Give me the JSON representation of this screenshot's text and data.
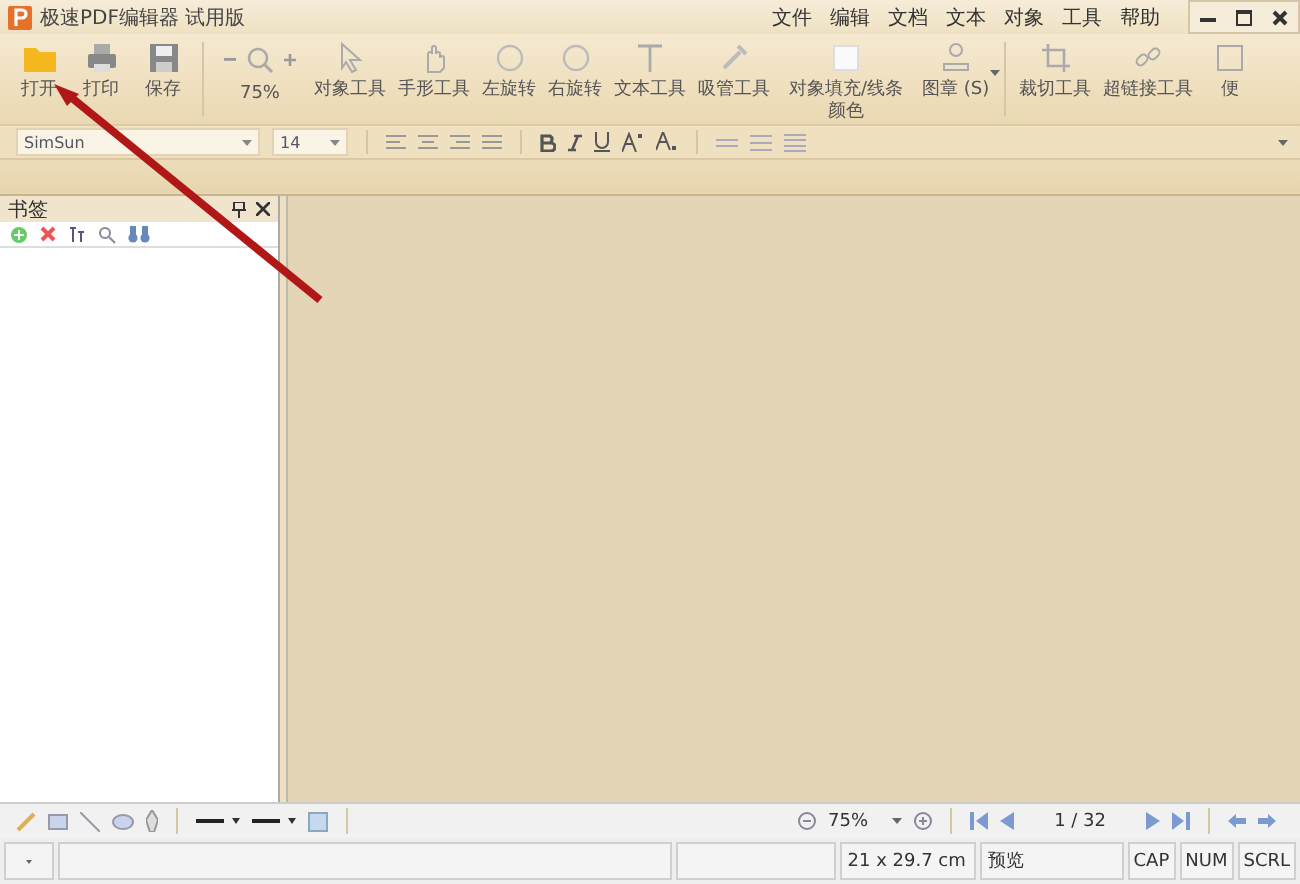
{
  "window": {
    "title": "极速PDF编辑器 试用版",
    "menu": [
      "文件",
      "编辑",
      "文档",
      "文本",
      "对象",
      "工具",
      "帮助"
    ]
  },
  "toolbar": {
    "items": [
      {
        "kind": "open",
        "label": "打开",
        "separator": false
      },
      {
        "kind": "print",
        "label": "打印",
        "separator": false
      },
      {
        "kind": "save",
        "label": "保存",
        "separator": false
      },
      {
        "kind": "zoom",
        "label": "75%",
        "separator": true
      },
      {
        "kind": "cursor",
        "label": "对象工具",
        "separator": false
      },
      {
        "kind": "hand",
        "label": "手形工具",
        "separator": false
      },
      {
        "kind": "rotate",
        "label": "左旋转",
        "separator": false
      },
      {
        "kind": "rotate",
        "label": "右旋转",
        "separator": false
      },
      {
        "kind": "text",
        "label": "文本工具",
        "separator": false
      },
      {
        "kind": "dropper",
        "label": "吸管工具",
        "separator": false
      },
      {
        "kind": "fill",
        "label": "对象填充/线条颜色",
        "separator": false
      },
      {
        "kind": "stamp",
        "label": "图章 (S)",
        "separator": false
      },
      {
        "kind": "crop",
        "label": "裁切工具",
        "separator": true
      },
      {
        "kind": "link",
        "label": "超链接工具",
        "separator": false
      },
      {
        "kind": "note",
        "label": "便",
        "separator": false
      }
    ]
  },
  "format_bar": {
    "font": "SimSun",
    "size": "14"
  },
  "bookmarks": {
    "title": "书签"
  },
  "navigation": {
    "zoom": "75%",
    "page": "1 / 32"
  },
  "status_bar": {
    "size": "21 x 29.7 cm",
    "mode": "预览",
    "keys": [
      "CAP",
      "NUM",
      "SCRL"
    ]
  }
}
